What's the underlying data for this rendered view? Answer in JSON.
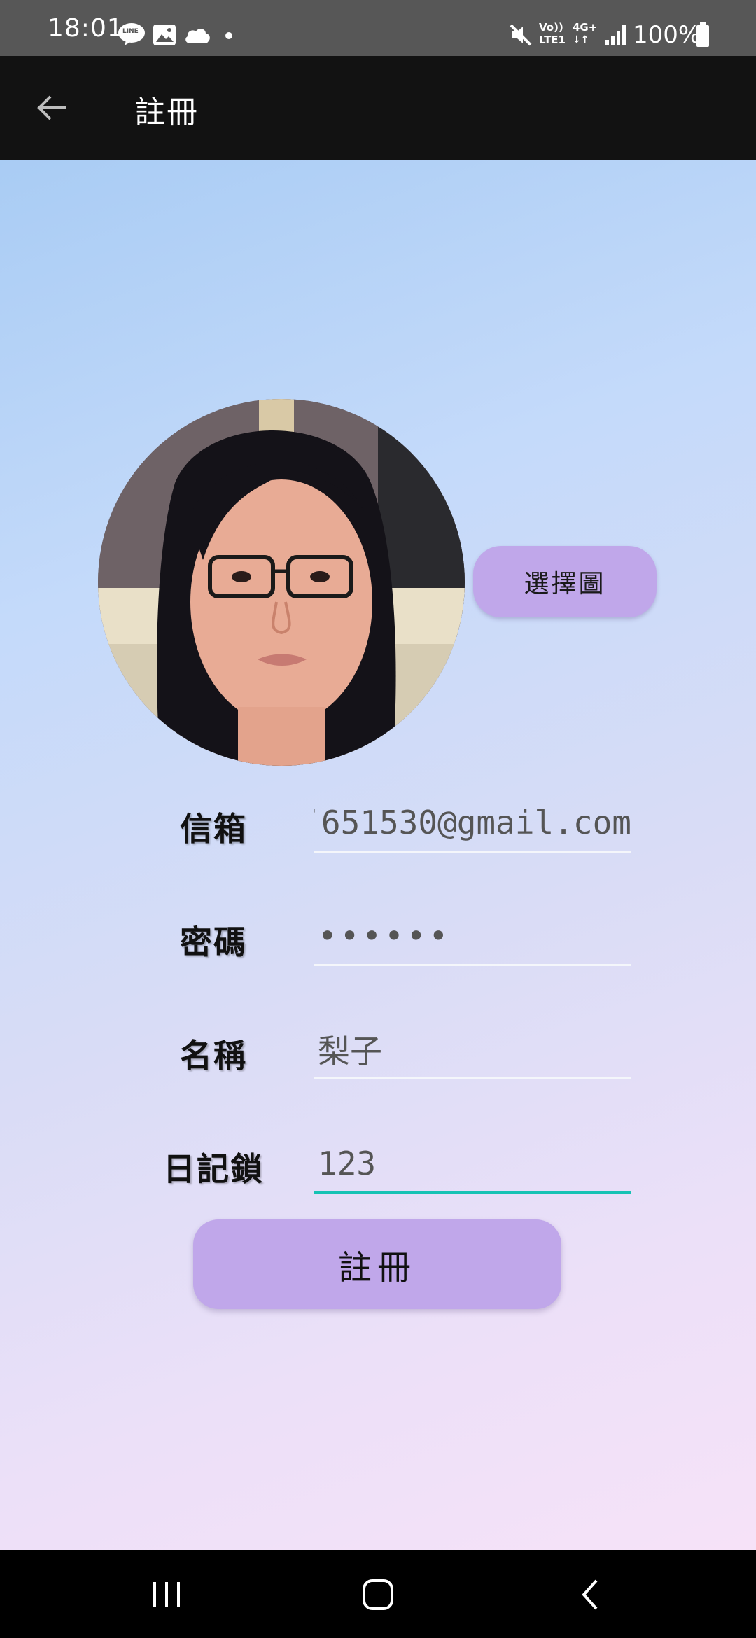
{
  "status_bar": {
    "time": "18:01",
    "left_icons": [
      "line-icon",
      "image-icon",
      "cloud-icon",
      "dot-icon"
    ],
    "line_badge": "LINE",
    "volte_top": "Vo))",
    "volte_bottom": "LTE1",
    "network": "4G+",
    "battery": "100%"
  },
  "app_bar": {
    "title": "註冊"
  },
  "avatar": {
    "choose_label": "選擇圖"
  },
  "form": {
    "email_label": "信箱",
    "email_value": "’651530@gmail.com",
    "password_label": "密碼",
    "password_value": "••••••",
    "name_label": "名稱",
    "name_value": "梨子",
    "diary_lock_label": "日記鎖",
    "diary_lock_value": "123"
  },
  "register_button": {
    "label": "註冊"
  },
  "colors": {
    "button_purple": "#c0a7ea",
    "focus_teal": "#16c2b4",
    "app_bar": "#121212",
    "status_bar": "#575757"
  },
  "nav_bar": {
    "icons": [
      "recent-apps-icon",
      "home-icon",
      "back-icon"
    ]
  }
}
